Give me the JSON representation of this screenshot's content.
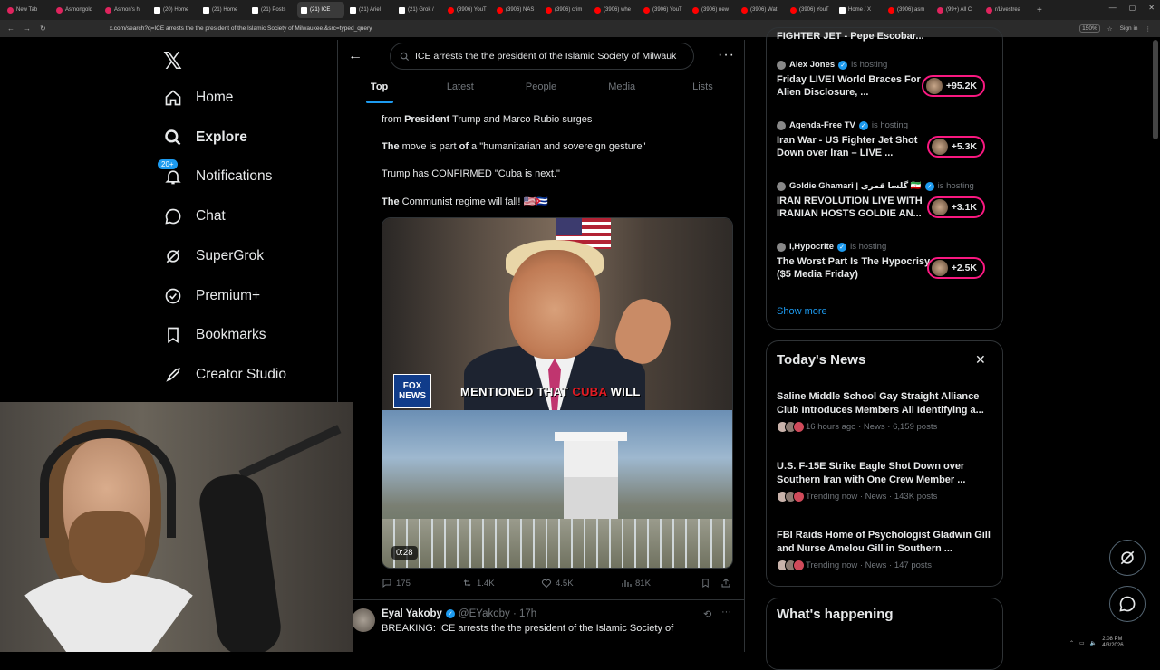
{
  "browser": {
    "tabs": [
      {
        "label": "New Tab",
        "icon": "tab-icon",
        "active": false
      },
      {
        "label": "Asmongold",
        "icon": "tab-icon",
        "active": false
      },
      {
        "label": "Asmon's h",
        "icon": "tab-icon",
        "active": false
      },
      {
        "label": "(20) Home",
        "icon": "x-icon",
        "active": false
      },
      {
        "label": "(21) Home",
        "icon": "x-icon",
        "active": false
      },
      {
        "label": "(21) Posts",
        "icon": "x-icon",
        "active": false
      },
      {
        "label": "(21) ICE",
        "icon": "x-icon",
        "active": true
      },
      {
        "label": "(21) Ariel",
        "icon": "x-icon",
        "active": false
      },
      {
        "label": "(21) Grok /",
        "icon": "x-icon",
        "active": false
      },
      {
        "label": "(3906) YouT",
        "icon": "youtube-icon",
        "active": false
      },
      {
        "label": "(3906) NAS",
        "icon": "youtube-icon",
        "active": false
      },
      {
        "label": "(3906) crim",
        "icon": "youtube-icon",
        "active": false
      },
      {
        "label": "(3906) whe",
        "icon": "youtube-icon",
        "active": false
      },
      {
        "label": "(3906) YouT",
        "icon": "youtube-icon",
        "active": false
      },
      {
        "label": "(3906) new",
        "icon": "youtube-icon",
        "active": false
      },
      {
        "label": "(3906) Wat",
        "icon": "youtube-icon",
        "active": false
      },
      {
        "label": "(3906) YouT",
        "icon": "youtube-icon",
        "active": false
      },
      {
        "label": "Home / X",
        "icon": "x-icon",
        "active": false
      },
      {
        "label": "(3906) asm",
        "icon": "youtube-icon",
        "active": false
      },
      {
        "label": "(99+) All C",
        "icon": "tab-icon",
        "active": false
      },
      {
        "label": "r/Livestrea",
        "icon": "tab-icon",
        "active": false
      }
    ],
    "url": "x.com/search?q=ICE arrests the the president of the Islamic Society of Milwaukee.&src=typed_query",
    "zoom": "150%",
    "sign_in": "Sign in"
  },
  "nav": {
    "items": [
      {
        "label": "Home",
        "icon": "home-icon"
      },
      {
        "label": "Explore",
        "icon": "search-icon"
      },
      {
        "label": "Notifications",
        "icon": "bell-icon",
        "badge": "20+"
      },
      {
        "label": "Chat",
        "icon": "chat-icon"
      },
      {
        "label": "SuperGrok",
        "icon": "grok-icon"
      },
      {
        "label": "Premium+",
        "icon": "verified-icon"
      },
      {
        "label": "Bookmarks",
        "icon": "bookmark-icon"
      },
      {
        "label": "Creator Studio",
        "icon": "rocket-icon"
      }
    ]
  },
  "search": {
    "query": "ICE arrests the the president of the Islamic Society of Milwauk"
  },
  "search_tabs": [
    "Top",
    "Latest",
    "People",
    "Media",
    "Lists"
  ],
  "post1": {
    "line1_prefix": "from ",
    "line1_bold": "President",
    "line1_suffix": " Trump and Marco Rubio surges",
    "line2_bold": "The",
    "line2_mid": " move is part ",
    "line2_bold2": "of",
    "line2_suffix": " a \"humanitarian and sovereign gesture\"",
    "line3": "Trump has CONFIRMED \"Cuba is next.\"",
    "line4_bold": "The",
    "line4_suffix": " Communist regime will fall! 🇺🇸🇨🇺",
    "video": {
      "fox_line1": "FOX",
      "fox_line2": "NEWS",
      "caption_white": "MENTIONED THAT ",
      "caption_red": "CUBA",
      "caption_end": " WILL",
      "duration": "0:28"
    },
    "stats": {
      "replies": "175",
      "reposts": "1.4K",
      "likes": "4.5K",
      "views": "81K"
    }
  },
  "post2": {
    "name": "Eyal Yakoby",
    "handle": "@EYakoby · 17h",
    "text": "BREAKING: ICE arrests the the president of the Islamic Society of"
  },
  "live": {
    "top_cut": "FIGHTER JET - Pepe Escobar...",
    "items": [
      {
        "host": "Alex Jones",
        "status": "is hosting",
        "title": "Friday LIVE! World Braces For Alien Disclosure, ...",
        "count": "+95.2K"
      },
      {
        "host": "Agenda-Free TV",
        "status": "is hosting",
        "title": "Iran War - US Fighter Jet Shot Down over Iran – LIVE ...",
        "count": "+5.3K"
      },
      {
        "host": "Goldie Ghamari | گلسا قمری 🇮🇷",
        "status": "is hosting",
        "title": "IRAN REVOLUTION LIVE WITH IRANIAN HOSTS GOLDIE AN...",
        "count": "+3.1K"
      },
      {
        "host": "I,Hypocrite",
        "status": "is hosting",
        "title": "The Worst Part Is The Hypocrisy ($5 Media Friday)",
        "count": "+2.5K"
      }
    ],
    "show_more": "Show more"
  },
  "news": {
    "title": "Today's News",
    "items": [
      {
        "title": "Saline Middle School Gay Straight Alliance Club Introduces Members All Identifying a...",
        "meta": "16 hours ago · News · 6,159 posts"
      },
      {
        "title": "U.S. F-15E Strike Eagle Shot Down over Southern Iran with One Crew Member ...",
        "meta": "Trending now · News · 143K posts"
      },
      {
        "title": "FBI Raids Home of Psychologist Gladwin Gill and Nurse Amelou Gill in Southern ...",
        "meta": "Trending now · News · 147 posts"
      }
    ]
  },
  "happening": "What's happening",
  "taskbar": {
    "time": "2:08 PM",
    "date": "4/3/2026"
  },
  "colors": {
    "accent": "#1d9bf0",
    "live_pill": "#f91880",
    "bg": "#000000",
    "muted": "#71767b"
  }
}
